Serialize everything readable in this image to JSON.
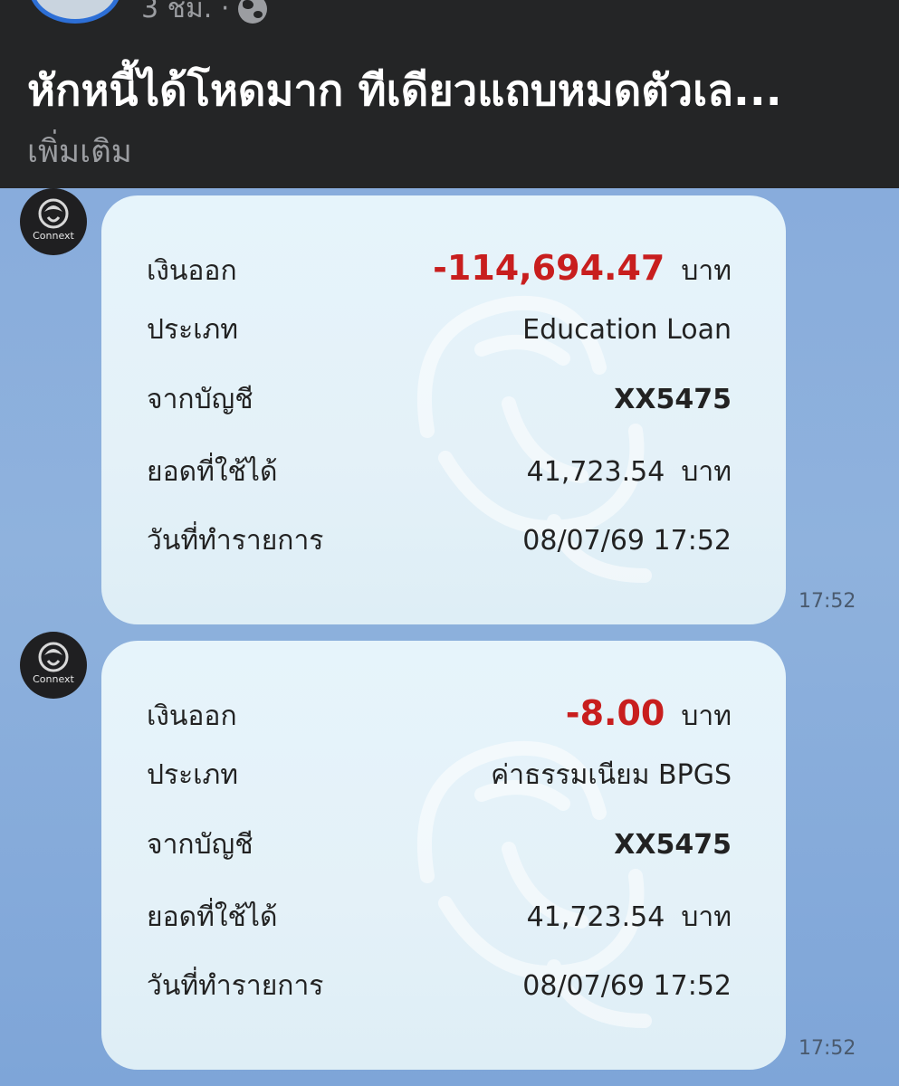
{
  "post": {
    "time": "3 ชม. ·",
    "title": "หักหนี้ได้โหดมาก ทีเดียวแถบหมดตัวเล...",
    "see_more": "เพิ่มเติม"
  },
  "bot": {
    "name": "Connext"
  },
  "messages": [
    {
      "outflow_label": "เงินออก",
      "amount": "-114,694.47",
      "unit": "บาท",
      "type_label": "ประเภท",
      "type_value": "Education Loan",
      "account_label": "จากบัญชี",
      "account_value": "XX5475",
      "balance_label": "ยอดที่ใช้ได้",
      "balance_value": "41,723.54",
      "date_label": "วันที่ทำรายการ",
      "date_value": "08/07/69 17:52",
      "time": "17:52"
    },
    {
      "outflow_label": "เงินออก",
      "amount": "-8.00",
      "unit": "บาท",
      "type_label": "ประเภท",
      "type_value": "ค่าธรรมเนียม BPGS",
      "account_label": "จากบัญชี",
      "account_value": "XX5475",
      "balance_label": "ยอดที่ใช้ได้",
      "balance_value": "41,723.54",
      "date_label": "วันที่ทำรายการ",
      "date_value": "08/07/69 17:52",
      "time": "17:52"
    }
  ],
  "colors": {
    "amount_red": "#c81e1e",
    "header_bg": "#242526",
    "chat_bg": "#88acdc"
  }
}
